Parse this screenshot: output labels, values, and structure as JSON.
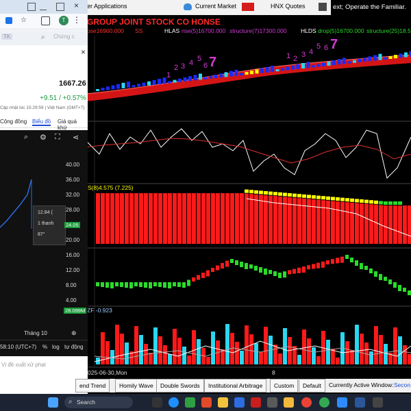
{
  "browser": {
    "tab_icons": [
      "tab-icon-1",
      "tab-icon-2"
    ],
    "addr_snippet": "TK",
    "addr_right": "Chứng c",
    "close": "×",
    "price": "1667.26",
    "change": "+9.51 / +0.57%",
    "updated": "Cập nhật lúc  15:29:59 | Việt Nam (GMT+7)",
    "nav": [
      "Cộng đồng",
      "Biểu đồ",
      "Giá quá khứ"
    ],
    "axis_left": [
      "40.00",
      "36.00",
      "32.00",
      "28.00",
      "24.00",
      "20.00"
    ],
    "tooltip": {
      "line1": "12.84 (",
      "line2": "1 thanh",
      "line3": "87°",
      "badge": "24.05"
    },
    "month": "Tháng 10",
    "timezone": "58:10 (UTC+7)",
    "pct": "%",
    "log": "log",
    "auto": "tự động",
    "footer": "Vị đề xuất xử phạt"
  },
  "topbar": {
    "apps": "er Applications",
    "current_market": "Current Market",
    "hnx": "HNX Quotes",
    "ticker": "ext; Operate the Familiar."
  },
  "title": "GROUP JOINT STOCK CO  HONSE",
  "subbar": {
    "left": "ose16900.000",
    "ss": "SS",
    "hlas_label": "HLAS",
    "hlas_rise": "rise(5)16700.000",
    "hlas_struct": "structure(7)17300.000",
    "hlds_label": "HLDS",
    "hlds_drop": "drop(5)16700.000",
    "hlds_struct": "structure(25)18.5"
  },
  "panel3_label": "S(8)4.575 (7.225)",
  "panel4_axis": [
    "16.00",
    "12.00",
    "8.00",
    "4.00"
  ],
  "panel4_badge": "28.099M",
  "panel5_label": "ZF -0.923",
  "date_label": "025-06-30,Mon",
  "date_mid": "8",
  "seq_numbers_1": [
    "1",
    "2",
    "3",
    "4",
    "5",
    "6",
    "7"
  ],
  "seq_numbers_2": [
    "1",
    "2",
    "3",
    "4",
    "5",
    "6",
    "7"
  ],
  "tabs": [
    "end Trend",
    "Homily Wave",
    "Double Swords",
    "Institutional Arbitrage",
    "Custom",
    "Default"
  ],
  "active_window_label": "Currently Active Window:",
  "active_window_value": "Secon",
  "taskbar": {
    "search": "Search"
  },
  "colors": {
    "red": "#ff1a1a",
    "green": "#2adb2a",
    "cyan": "#2ad7f0",
    "blue": "#1a2cff",
    "yellow": "#ffff00",
    "magenta": "#d33bd3"
  }
}
